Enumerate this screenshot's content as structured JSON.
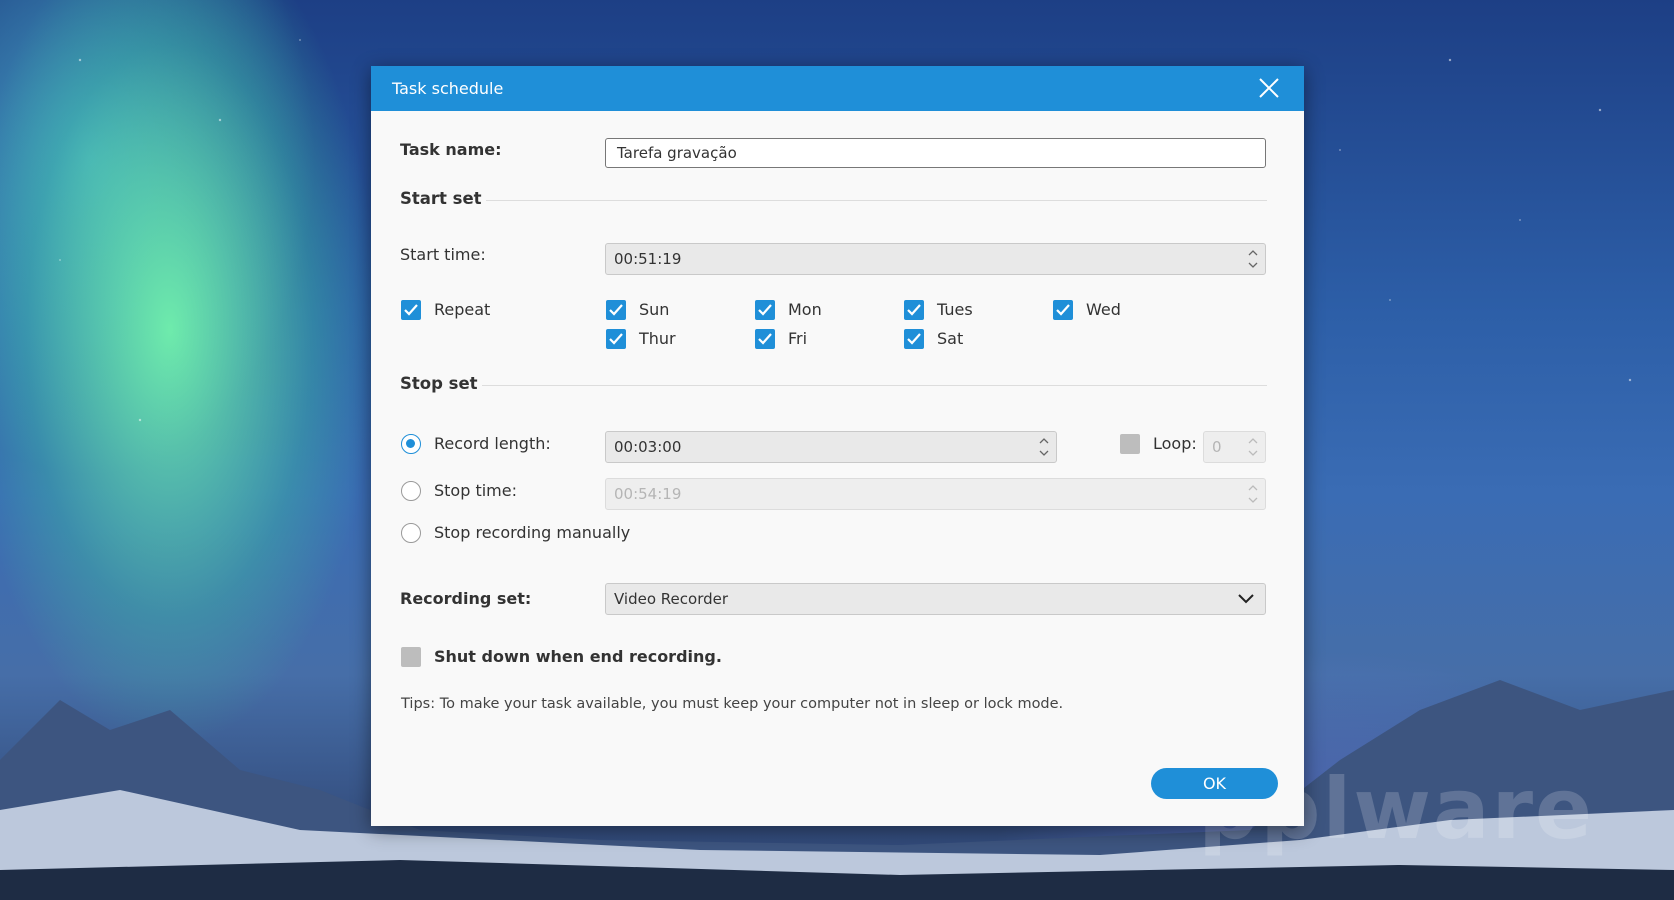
{
  "dialog": {
    "title": "Task schedule",
    "task_name_label": "Task name:",
    "task_name_value": "Tarefa gravação",
    "start_set": {
      "heading": "Start set",
      "start_time_label": "Start time:",
      "start_time_value": "00:51:19",
      "repeat_label": "Repeat",
      "repeat_checked": true,
      "days": [
        {
          "label": "Sun",
          "checked": true
        },
        {
          "label": "Mon",
          "checked": true
        },
        {
          "label": "Tues",
          "checked": true
        },
        {
          "label": "Wed",
          "checked": true
        },
        {
          "label": "Thur",
          "checked": true
        },
        {
          "label": "Fri",
          "checked": true
        },
        {
          "label": "Sat",
          "checked": true
        }
      ]
    },
    "stop_set": {
      "heading": "Stop set",
      "record_length_label": "Record length:",
      "record_length_value": "00:03:00",
      "record_length_selected": true,
      "loop_label": "Loop:",
      "loop_value": "0",
      "loop_checked": false,
      "stop_time_label": "Stop time:",
      "stop_time_value": "00:54:19",
      "stop_manually_label": "Stop recording manually"
    },
    "recording_set_label": "Recording set:",
    "recording_set_value": "Video Recorder",
    "shutdown_label": "Shut down when end recording.",
    "shutdown_checked": false,
    "tips": "Tips: To make your task available, you must keep your computer not in sleep or lock mode.",
    "ok_label": "OK"
  },
  "watermark": "pplware",
  "colors": {
    "accent": "#1f8fd8",
    "dialog_bg": "#f9f9f9",
    "field_bg": "#e9e9e9"
  }
}
